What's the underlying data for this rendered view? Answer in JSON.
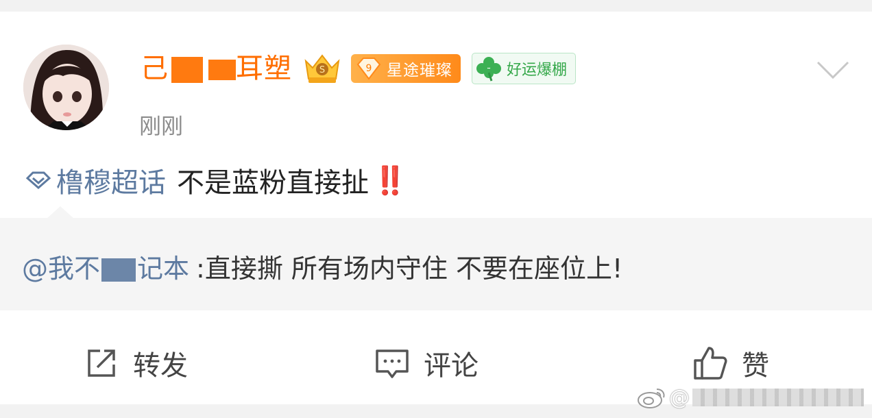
{
  "post": {
    "author": {
      "name_prefix": "己",
      "name_suffix": "耳塑",
      "avatar_alt": "avatar"
    },
    "level_badge": {
      "level": "9",
      "label": "星途璀璨"
    },
    "luck_badge": {
      "label": "好运爆棚"
    },
    "timestamp": "刚刚",
    "topic": "橹穆超话",
    "body": "不是蓝粉直接扯",
    "alarm": "‼️",
    "quote": {
      "user_prefix": "@我不",
      "user_suffix": "记本",
      "text": ":直接撕 所有场内守住 不要在座位上!"
    }
  },
  "actions": {
    "repost_label": "转发",
    "comment_label": "评论",
    "like_label": "赞"
  },
  "watermark": {
    "at": "@"
  },
  "colors": {
    "username": "#ff6e00",
    "link": "#5d7aa0",
    "level_badge": "#ff8a1a",
    "luck_badge": "#35a84a",
    "alarm": "#d8282f"
  }
}
